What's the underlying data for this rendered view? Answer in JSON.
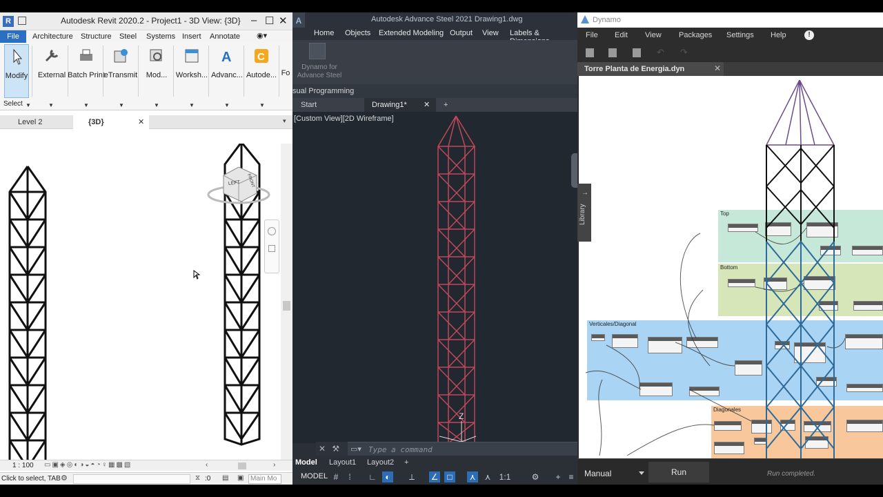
{
  "revit": {
    "title": "Autodesk Revit 2020.2 - Project1 - 3D View: {3D}",
    "menu": {
      "file": "File",
      "items": [
        "Architecture",
        "Structure",
        "Steel",
        "Systems",
        "Insert",
        "Annotate"
      ]
    },
    "ribbon": {
      "buttons": [
        "Modify",
        "External",
        "Batch Print",
        "eTransmit",
        "Mod...",
        "Worksh...",
        "Advanc...",
        "Autode...",
        "Fo"
      ],
      "select": "Select"
    },
    "view_tabs": {
      "level": "Level 2",
      "view3d": "{3D}"
    },
    "viewcube": {
      "left": "LEFT",
      "front": "FRONT"
    },
    "viewbar": {
      "scale": "1 : 100"
    },
    "status": {
      "text": "Click to select, TAB",
      "zero": ":0",
      "model": "Main Mo"
    }
  },
  "steel": {
    "title": "Autodesk Advance Steel 2021    Drawing1.dwg",
    "menu": [
      "Home",
      "Objects",
      "Extended Modeling",
      "Output",
      "View",
      "Labels & Dimensions"
    ],
    "ribbon": {
      "dynamo_label": "Dynamo for Advance Steel"
    },
    "panel_name": "sual Programming",
    "doc_tabs": {
      "start": "Start",
      "drawing": "Drawing1*"
    },
    "view_label": "[Custom View][2D Wireframe]",
    "axis_z": "Z",
    "command_placeholder": "Type a command",
    "layout_tabs": [
      "Model",
      "Layout1",
      "Layout2"
    ],
    "status": {
      "model": "MODEL",
      "scale": "1:1"
    }
  },
  "dynamo": {
    "title": "Dynamo",
    "menu": [
      "File",
      "Edit",
      "View",
      "Packages",
      "Settings",
      "Help"
    ],
    "tab": "Torre Planta de Energia.dyn",
    "library": "Library",
    "groups": [
      "Top",
      "Bottom",
      "Verticales/Diagonal",
      "Diagonales"
    ],
    "run_mode": "Manual",
    "run_button": "Run",
    "status": "Run completed.",
    "colors": {
      "top": "#c6e8d8",
      "bottom": "#d6e6b8",
      "verticales": "#a9d4f4",
      "diagonales": "#f8c79c"
    }
  }
}
